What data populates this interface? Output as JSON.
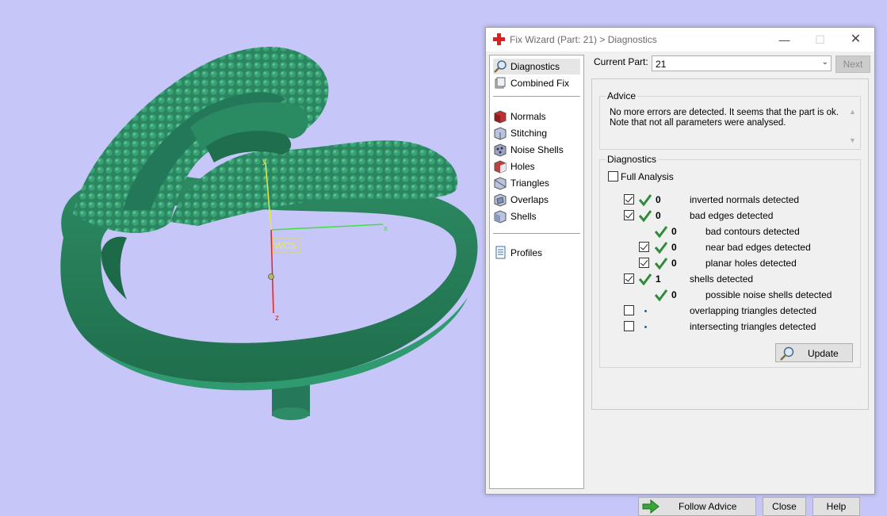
{
  "viewport": {
    "wcs_label": "WCS",
    "axis_x_label": "x",
    "axis_y_label": "y",
    "axis_z_label": "z",
    "model_color": "#2f8a63",
    "background_color": "#c6c6f8"
  },
  "dialog": {
    "title": "Fix Wizard (Part: 21) > Diagnostics",
    "app_icon": "red-cross-icon",
    "minimize_glyph": "—",
    "maximize_glyph": "☐",
    "close_glyph": "✕"
  },
  "nav": {
    "items": [
      {
        "label": "Diagnostics",
        "icon": "magnifier-icon",
        "selected": true
      },
      {
        "label": "Combined Fix",
        "icon": "combined-fix-icon"
      },
      {
        "label": "Normals",
        "icon": "normals-icon"
      },
      {
        "label": "Stitching",
        "icon": "stitching-icon"
      },
      {
        "label": "Noise Shells",
        "icon": "noise-shells-icon"
      },
      {
        "label": "Holes",
        "icon": "holes-icon"
      },
      {
        "label": "Triangles",
        "icon": "triangles-icon"
      },
      {
        "label": "Overlaps",
        "icon": "overlaps-icon"
      },
      {
        "label": "Shells",
        "icon": "shells-icon"
      },
      {
        "label": "Profiles",
        "icon": "profiles-icon"
      }
    ]
  },
  "current_part": {
    "label": "Current Part:",
    "value": "21",
    "next_label": "Next"
  },
  "advice": {
    "title": "Advice",
    "text": "No more errors are detected. It seems that the part is ok. Note that not all parameters were analysed."
  },
  "diagnostics": {
    "title": "Diagnostics",
    "full_analysis_label": "Full Analysis",
    "full_analysis_checked": false,
    "rows": [
      {
        "count": "0",
        "label": "inverted normals detected",
        "checked": true,
        "status": "ok"
      },
      {
        "count": "0",
        "label": "bad edges detected",
        "checked": true,
        "status": "ok"
      },
      {
        "count": "0",
        "label": "bad contours detected",
        "status": "ok"
      },
      {
        "count": "0",
        "label": "near bad edges detected",
        "checked": true,
        "status": "ok"
      },
      {
        "count": "0",
        "label": "planar holes detected",
        "checked": true,
        "status": "ok"
      },
      {
        "count": "1",
        "label": "shells detected",
        "checked": true,
        "status": "ok"
      },
      {
        "count": "0",
        "label": "possible noise shells detected",
        "status": "ok"
      },
      {
        "count": "",
        "label": "overlapping triangles detected",
        "checked": false,
        "status": "not-analysed"
      },
      {
        "count": "",
        "label": "intersecting triangles detected",
        "checked": false,
        "status": "not-analysed"
      }
    ],
    "update_label": "Update"
  },
  "buttons": {
    "follow_advice": "Follow Advice",
    "close": "Close",
    "help": "Help"
  },
  "colors": {
    "tick_green": "#2e8b3a",
    "arrow_green": "#3aa63a"
  }
}
